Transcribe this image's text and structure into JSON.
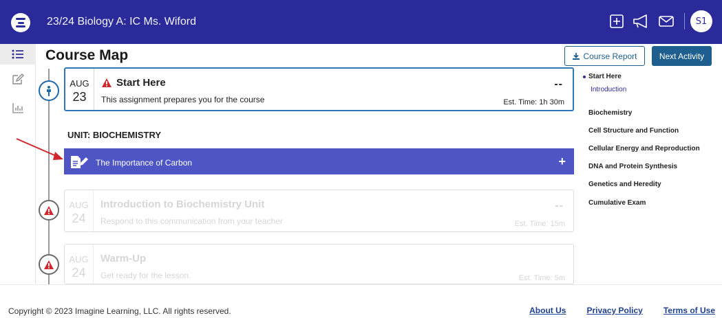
{
  "header": {
    "course_title": "23/24 Biology A: IC Ms. Wiford",
    "avatar_initials": "S1",
    "icons": [
      "add-square-icon",
      "megaphone-icon",
      "mail-icon"
    ]
  },
  "siderail": {
    "items": [
      {
        "icon": "list-icon",
        "active": true
      },
      {
        "icon": "edit-icon",
        "active": false
      },
      {
        "icon": "bar-chart-icon",
        "active": false
      }
    ]
  },
  "page": {
    "title": "Course Map",
    "course_report_label": "Course Report",
    "next_activity_label": "Next Activity"
  },
  "activities": {
    "start_here": {
      "month": "AUG",
      "day": "23",
      "title": "Start Here",
      "description": "This assignment prepares you for the course",
      "score": "--",
      "est_time": "Est. Time: 1h 30m"
    },
    "unit_label": "UNIT: BIOCHEMISTRY",
    "lesson": {
      "title": "The Importance of Carbon",
      "toggle": "+"
    },
    "intro": {
      "month": "AUG",
      "day": "24",
      "title": "Introduction to Biochemistry Unit",
      "description": "Respond to this communication from your teacher",
      "score": "--",
      "est_time": "Est. Time: 15m"
    },
    "warmup": {
      "month": "AUG",
      "day": "24",
      "title": "Warm-Up",
      "description": "Get ready for the lesson.",
      "est_time": "Est. Time: 5m"
    }
  },
  "toc": {
    "items": [
      "Start Here",
      "Introduction",
      "Biochemistry",
      "Cell Structure and Function",
      "Cellular Energy and Reproduction",
      "DNA and Protein Synthesis",
      "Genetics and Heredity",
      "Cumulative Exam"
    ]
  },
  "footer": {
    "copyright": "Copyright © 2023 Imagine Learning, LLC. All rights reserved.",
    "about": "About Us",
    "privacy": "Privacy Policy",
    "terms": "Terms of Use"
  },
  "colors": {
    "header_bg": "#2a2a9b",
    "lesson_bar": "#4d56c4",
    "primary_button": "#1f5f8f",
    "warning": "#d0262c",
    "annotation_arrow": "#d0262c"
  }
}
